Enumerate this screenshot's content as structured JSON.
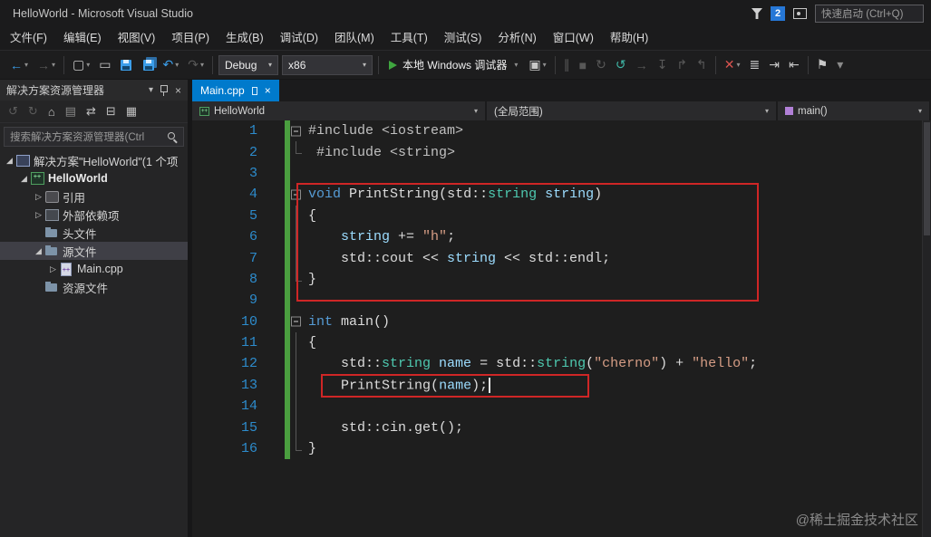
{
  "window": {
    "title": "HelloWorld - Microsoft Visual Studio",
    "notification_count": "2",
    "quick_launch": "快速启动 (Ctrl+Q)"
  },
  "menu": [
    {
      "id": "file",
      "label": "文件(F)"
    },
    {
      "id": "edit",
      "label": "编辑(E)"
    },
    {
      "id": "view",
      "label": "视图(V)"
    },
    {
      "id": "project",
      "label": "项目(P)"
    },
    {
      "id": "build",
      "label": "生成(B)"
    },
    {
      "id": "debug",
      "label": "调试(D)"
    },
    {
      "id": "team",
      "label": "团队(M)"
    },
    {
      "id": "tools",
      "label": "工具(T)"
    },
    {
      "id": "test",
      "label": "测试(S)"
    },
    {
      "id": "analyze",
      "label": "分析(N)"
    },
    {
      "id": "window",
      "label": "窗口(W)"
    },
    {
      "id": "help",
      "label": "帮助(H)"
    }
  ],
  "toolbar": {
    "debug_config": "Debug",
    "platform": "x86",
    "start_label": "本地 Windows 调试器",
    "items": [
      {
        "type": "icon",
        "name": "nav-back-icon",
        "glyph": "←",
        "cls": "blue",
        "dd": true
      },
      {
        "type": "icon",
        "name": "nav-forward-icon",
        "glyph": "→",
        "cls": "disabled",
        "dd": true
      },
      {
        "type": "sep"
      },
      {
        "type": "icon",
        "name": "new-file-icon",
        "glyph": "▢",
        "cls": "light",
        "dd": true
      },
      {
        "type": "icon",
        "name": "open-file-icon",
        "glyph": "▭",
        "cls": "light"
      },
      {
        "type": "icon",
        "name": "save-icon",
        "cls": "floppy"
      },
      {
        "type": "icon",
        "name": "save-all-icon",
        "cls": "floppy-all"
      },
      {
        "type": "icon",
        "name": "undo-icon",
        "glyph": "↶",
        "cls": "blue",
        "dd": true
      },
      {
        "type": "icon",
        "name": "redo-icon",
        "glyph": "↷",
        "cls": "disabled",
        "dd": true
      },
      {
        "type": "sep"
      },
      {
        "type": "combo",
        "name": "solution-config-select",
        "value": "debug_config",
        "w": 66
      },
      {
        "type": "combo",
        "name": "solution-platform-select",
        "value": "platform",
        "w": 100
      },
      {
        "type": "sep"
      },
      {
        "type": "start"
      },
      {
        "type": "icon",
        "name": "attach-process-icon",
        "glyph": "▣",
        "cls": "light",
        "dd": true
      },
      {
        "type": "sep"
      },
      {
        "type": "icon",
        "name": "break-all-icon",
        "glyph": "∥",
        "cls": "disabled"
      },
      {
        "type": "icon",
        "name": "stop-debug-icon",
        "glyph": "■",
        "cls": "disabled"
      },
      {
        "type": "icon",
        "name": "restart-icon",
        "glyph": "↻",
        "cls": "disabled"
      },
      {
        "type": "icon",
        "name": "apply-code-changes-icon",
        "glyph": "↺",
        "cls": "teal"
      },
      {
        "type": "icon",
        "name": "show-next-statement-icon",
        "glyph": "→",
        "cls": "disabled"
      },
      {
        "type": "icon",
        "name": "step-into-icon",
        "glyph": "↧",
        "cls": "disabled"
      },
      {
        "type": "icon",
        "name": "step-over-icon",
        "glyph": "↱",
        "cls": "disabled"
      },
      {
        "type": "icon",
        "name": "step-out-icon",
        "glyph": "↰",
        "cls": "disabled"
      },
      {
        "type": "sep"
      },
      {
        "type": "icon",
        "name": "diagnostic-tool-icon",
        "glyph": "✕",
        "cls": "red",
        "dd": true
      },
      {
        "type": "icon",
        "name": "line-tools-icon",
        "glyph": "≣",
        "cls": "light"
      },
      {
        "type": "icon",
        "name": "indent-icon",
        "glyph": "⇥",
        "cls": "light"
      },
      {
        "type": "icon",
        "name": "outdent-icon",
        "glyph": "⇤",
        "cls": "light"
      },
      {
        "type": "sep"
      },
      {
        "type": "icon",
        "name": "bookmark-icon",
        "glyph": "⚑",
        "cls": "light"
      },
      {
        "type": "icon",
        "name": "toolbar-options-icon",
        "glyph": "▾",
        "cls": "dim"
      }
    ]
  },
  "sidebar_tools": [
    {
      "name": "back-circle-icon",
      "glyph": "↺",
      "cls": "disabled"
    },
    {
      "name": "forward-circle-icon",
      "glyph": "↻",
      "cls": "disabled"
    },
    {
      "name": "home-icon",
      "glyph": "⌂",
      "cls": ""
    },
    {
      "name": "pending-changes-filter-icon",
      "glyph": "▤",
      "cls": "dim"
    },
    {
      "name": "sync-with-active-document-icon",
      "glyph": "⇄",
      "cls": ""
    },
    {
      "name": "collapse-all-icon",
      "glyph": "⊟",
      "cls": ""
    },
    {
      "name": "properties-icon",
      "glyph": "▦",
      "cls": ""
    }
  ],
  "solution_explorer": {
    "title": "解决方案资源管理器",
    "search_text": "搜索解决方案资源管理器(Ctrl",
    "tree": [
      {
        "name": "solution",
        "label": "解决方案\"HelloWorld\"(1 个项",
        "level": 0,
        "arrow": "expanded",
        "icon": "solution"
      },
      {
        "name": "project-helloworld",
        "label": "HelloWorld",
        "level": 1,
        "arrow": "expanded",
        "icon": "project-cpp",
        "bold": true
      },
      {
        "name": "references",
        "label": "引用",
        "level": 2,
        "arrow": "collapsed",
        "icon": "references"
      },
      {
        "name": "external-dependencies",
        "label": "外部依赖项",
        "level": 2,
        "arrow": "collapsed",
        "icon": "dependencies"
      },
      {
        "name": "header-files",
        "label": "头文件",
        "level": 2,
        "arrow": "none",
        "icon": "folder"
      },
      {
        "name": "source-files",
        "label": "源文件",
        "level": 2,
        "arrow": "expanded",
        "icon": "folder",
        "selected": true
      },
      {
        "name": "main-cpp",
        "label": "Main.cpp",
        "level": 3,
        "arrow": "collapsed",
        "icon": "file-cpp"
      },
      {
        "name": "resource-files",
        "label": "资源文件",
        "level": 2,
        "arrow": "none",
        "icon": "folder"
      }
    ]
  },
  "editor": {
    "tab_label": "Main.cpp",
    "breadcrumb": {
      "project": "HelloWorld",
      "scope": "(全局范围)",
      "member": "main()"
    },
    "code": {
      "lines": [
        {
          "n": 1,
          "fold": "open",
          "changed": true,
          "tokens": [
            {
              "t": "#include <iostream>",
              "c": "pre"
            }
          ]
        },
        {
          "n": 2,
          "fold": "end",
          "changed": true,
          "tokens": [
            {
              "t": " #include <string>",
              "c": "pre"
            }
          ]
        },
        {
          "n": 3,
          "fold": "none",
          "changed": true,
          "tokens": []
        },
        {
          "n": 4,
          "fold": "open",
          "changed": true,
          "tokens": [
            {
              "t": "void",
              "c": "kw"
            },
            {
              "t": " ",
              "c": "pl"
            },
            {
              "t": "PrintString",
              "c": "fn"
            },
            {
              "t": "(",
              "c": "pl"
            },
            {
              "t": "std::",
              "c": "pl"
            },
            {
              "t": "string",
              "c": "ty"
            },
            {
              "t": " ",
              "c": "pl"
            },
            {
              "t": "string",
              "c": "va"
            },
            {
              "t": ")",
              "c": "pl"
            }
          ]
        },
        {
          "n": 5,
          "fold": "guide",
          "changed": true,
          "tokens": [
            {
              "t": "{",
              "c": "pl"
            }
          ]
        },
        {
          "n": 6,
          "fold": "guide",
          "changed": true,
          "tokens": [
            {
              "t": "    ",
              "c": "pl"
            },
            {
              "t": "string",
              "c": "va"
            },
            {
              "t": " += ",
              "c": "pl"
            },
            {
              "t": "\"h\"",
              "c": "st"
            },
            {
              "t": ";",
              "c": "pl"
            }
          ]
        },
        {
          "n": 7,
          "fold": "guide",
          "changed": true,
          "tokens": [
            {
              "t": "    std::cout << ",
              "c": "pl"
            },
            {
              "t": "string",
              "c": "va"
            },
            {
              "t": " << std::endl;",
              "c": "pl"
            }
          ]
        },
        {
          "n": 8,
          "fold": "end",
          "changed": true,
          "tokens": [
            {
              "t": "}",
              "c": "pl"
            }
          ]
        },
        {
          "n": 9,
          "fold": "none",
          "changed": true,
          "tokens": []
        },
        {
          "n": 10,
          "fold": "open",
          "changed": true,
          "tokens": [
            {
              "t": "int",
              "c": "kw"
            },
            {
              "t": " ",
              "c": "pl"
            },
            {
              "t": "main",
              "c": "fn"
            },
            {
              "t": "()",
              "c": "pl"
            }
          ]
        },
        {
          "n": 11,
          "fold": "guide",
          "changed": true,
          "tokens": [
            {
              "t": "{",
              "c": "pl"
            }
          ]
        },
        {
          "n": 12,
          "fold": "guide",
          "changed": true,
          "tokens": [
            {
              "t": "    std::",
              "c": "pl"
            },
            {
              "t": "string",
              "c": "ty"
            },
            {
              "t": " ",
              "c": "pl"
            },
            {
              "t": "name",
              "c": "va"
            },
            {
              "t": " = std::",
              "c": "pl"
            },
            {
              "t": "string",
              "c": "ty"
            },
            {
              "t": "(",
              "c": "pl"
            },
            {
              "t": "\"cherno\"",
              "c": "st"
            },
            {
              "t": ") + ",
              "c": "pl"
            },
            {
              "t": "\"hello\"",
              "c": "st"
            },
            {
              "t": ";",
              "c": "pl"
            }
          ]
        },
        {
          "n": 13,
          "fold": "guide",
          "changed": true,
          "tokens": [
            {
              "t": "    ",
              "c": "pl"
            },
            {
              "t": "PrintString",
              "c": "fn"
            },
            {
              "t": "(",
              "c": "pl"
            },
            {
              "t": "name",
              "c": "va"
            },
            {
              "t": ");",
              "c": "pl"
            },
            {
              "c": "caret"
            }
          ]
        },
        {
          "n": 14,
          "fold": "guide",
          "changed": true,
          "tokens": []
        },
        {
          "n": 15,
          "fold": "guide",
          "changed": true,
          "tokens": [
            {
              "t": "    std::cin.get();",
              "c": "pl"
            }
          ]
        },
        {
          "n": 16,
          "fold": "end",
          "changed": true,
          "tokens": [
            {
              "t": "}",
              "c": "pl"
            }
          ]
        }
      ]
    }
  },
  "annotations": {
    "color": "#cf2626",
    "boxes": [
      {
        "name": "annotation-box-printstring-function",
        "target": "lines 4-9"
      },
      {
        "name": "annotation-box-printstring-call",
        "target": "line 13"
      }
    ]
  },
  "icons": {
    "close": "×",
    "chevron_down": "▾",
    "tree_expanded": "◢",
    "tree_collapsed": "▷"
  },
  "colors": {
    "accent": "#007acc",
    "line_number": "#2d8ccd",
    "change_bar": "#4a9e3f",
    "annotation_red": "#cf2626",
    "start_green": "#3fa63f"
  },
  "watermark": "@稀土掘金技术社区"
}
